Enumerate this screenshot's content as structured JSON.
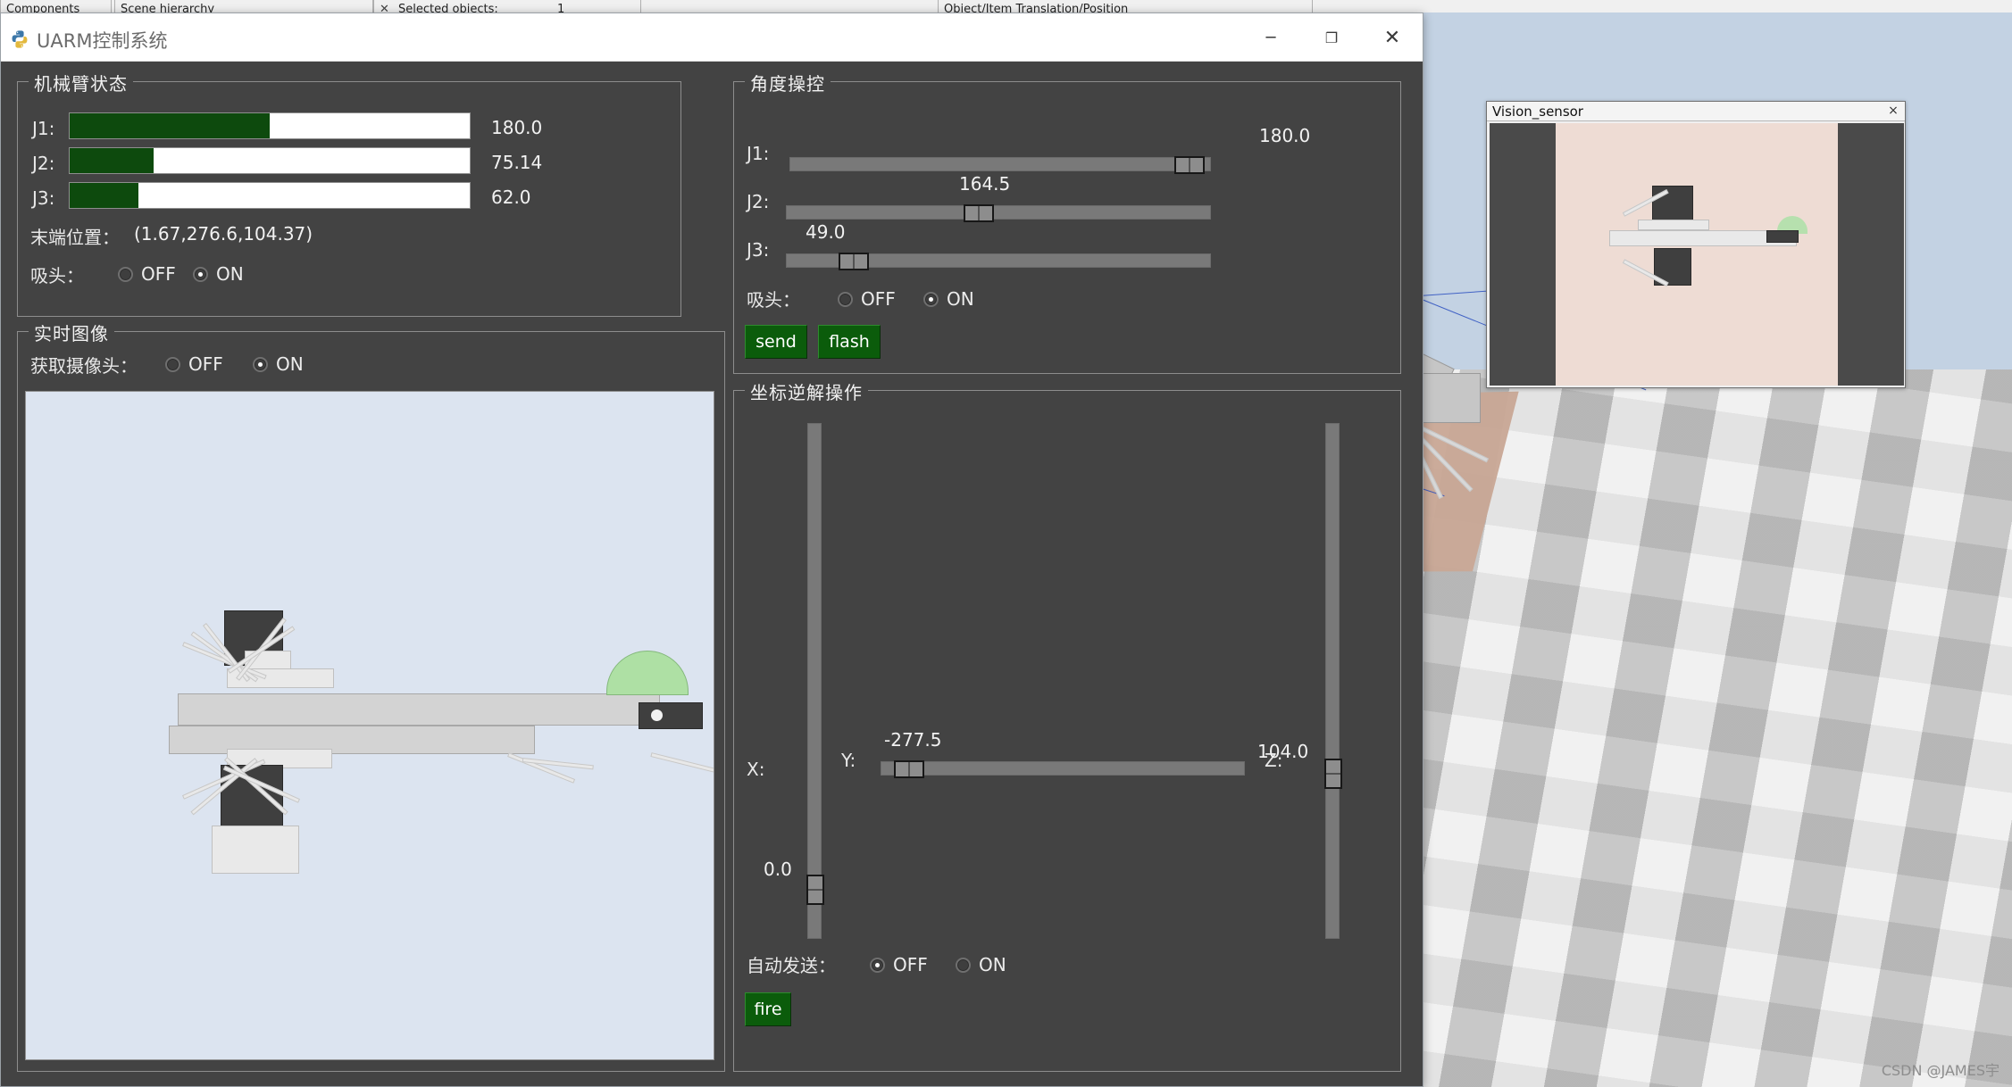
{
  "sim_toolbar": {
    "items": [
      {
        "label": "Components"
      },
      {
        "label": "Scene hierarchy"
      },
      {
        "label": "Selected objects:"
      },
      {
        "label": "1"
      },
      {
        "label": "Object/Item Translation/Position"
      }
    ]
  },
  "vision_window": {
    "title": "Vision_sensor",
    "close_label": "×"
  },
  "watermark": "CSDN @JAMES宇",
  "window": {
    "title": "UARM控制系统",
    "minimize_label": "─",
    "maximize_label": "❐",
    "close_label": "✕"
  },
  "arm_status": {
    "title": "机械臂状态",
    "joints": [
      {
        "label": "J1:",
        "value": "180.0",
        "percent": 50
      },
      {
        "label": "J2:",
        "value": "75.14",
        "percent": 20.9
      },
      {
        "label": "J3:",
        "value": "62.0",
        "percent": 17.2
      }
    ],
    "end_position_label": "末端位置：",
    "end_position_value": "(1.67,276.6,104.37)",
    "suction_label": "吸头：",
    "suction_off_label": "OFF",
    "suction_on_label": "ON",
    "suction_selected": "ON"
  },
  "realtime_image": {
    "title": "实时图像",
    "camera_label": "获取摄像头：",
    "camera_off_label": "OFF",
    "camera_on_label": "ON",
    "camera_selected": "ON"
  },
  "angle_control": {
    "title": "角度操控",
    "sliders": [
      {
        "label": "J1:",
        "value": "180.0",
        "percent": 93.5
      },
      {
        "label": "J2:",
        "value": "164.5",
        "percent": 44.5
      },
      {
        "label": "J3:",
        "value": "49.0",
        "percent": 15.0
      }
    ],
    "suction_label": "吸头：",
    "suction_off_label": "OFF",
    "suction_on_label": "ON",
    "suction_selected": "ON",
    "send_label": "send",
    "flash_label": "flash"
  },
  "inverse_kinematics": {
    "title": "坐标逆解操作",
    "x": {
      "label": "X:",
      "value": "0.0",
      "percent": 97
    },
    "y": {
      "label": "Y:",
      "value": "-277.5",
      "percent": 5
    },
    "z": {
      "label": "Z:",
      "value": "104.0",
      "percent": 71
    },
    "auto_send_label": "自动发送：",
    "auto_send_off_label": "OFF",
    "auto_send_on_label": "ON",
    "auto_send_selected": "OFF",
    "fire_label": "fire"
  },
  "colors": {
    "panel_bg": "#434343",
    "bar_fill": "#0d4a0d",
    "button_green": "#0b5c0b",
    "accent_text": "#f2f2f2"
  }
}
